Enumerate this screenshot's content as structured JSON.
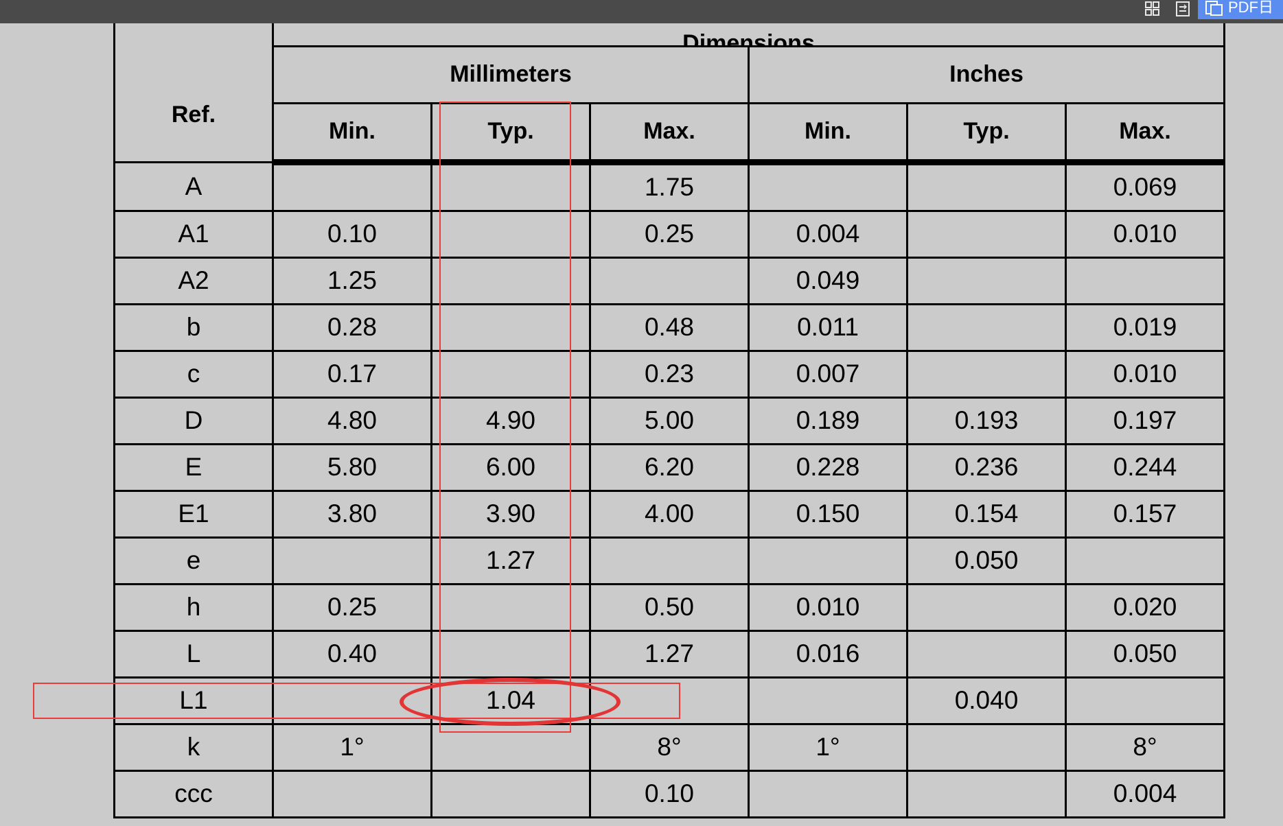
{
  "toolbar": {
    "icons": [
      "grid-view-icon",
      "compare-icon",
      "pdf-convert-icon"
    ],
    "pdf_button_label": "PDF",
    "pdf_button_trailing": "日",
    "colors": {
      "bar": "#4a4a4a",
      "pdf_button": "#5b8df0"
    }
  },
  "table": {
    "title": "Dimensions",
    "ref_header": "Ref.",
    "group_headers": [
      "Millimeters",
      "Inches"
    ],
    "sub_headers": [
      "Min.",
      "Typ.",
      "Max.",
      "Min.",
      "Typ.",
      "Max."
    ],
    "rows": [
      [
        "A",
        "",
        "",
        "1.75",
        "",
        "",
        "0.069"
      ],
      [
        "A1",
        "0.10",
        "",
        "0.25",
        "0.004",
        "",
        "0.010"
      ],
      [
        "A2",
        "1.25",
        "",
        "",
        "0.049",
        "",
        ""
      ],
      [
        "b",
        "0.28",
        "",
        "0.48",
        "0.011",
        "",
        "0.019"
      ],
      [
        "c",
        "0.17",
        "",
        "0.23",
        "0.007",
        "",
        "0.010"
      ],
      [
        "D",
        "4.80",
        "4.90",
        "5.00",
        "0.189",
        "0.193",
        "0.197"
      ],
      [
        "E",
        "5.80",
        "6.00",
        "6.20",
        "0.228",
        "0.236",
        "0.244"
      ],
      [
        "E1",
        "3.80",
        "3.90",
        "4.00",
        "0.150",
        "0.154",
        "0.157"
      ],
      [
        "e",
        "",
        "1.27",
        "",
        "",
        "0.050",
        ""
      ],
      [
        "h",
        "0.25",
        "",
        "0.50",
        "0.010",
        "",
        "0.020"
      ],
      [
        "L",
        "0.40",
        "",
        "1.27",
        "0.016",
        "",
        "0.050"
      ],
      [
        "L1",
        "",
        "1.04",
        "",
        "",
        "0.040",
        ""
      ],
      [
        "k",
        "1°",
        "",
        "8°",
        "1°",
        "",
        "8°"
      ],
      [
        "ccc",
        "",
        "",
        "0.10",
        "",
        "",
        "0.004"
      ]
    ]
  },
  "annotations": {
    "color": "#e23636",
    "highlighted_column": "Typ.",
    "highlighted_row": "L1",
    "circled_value": "1.04"
  }
}
